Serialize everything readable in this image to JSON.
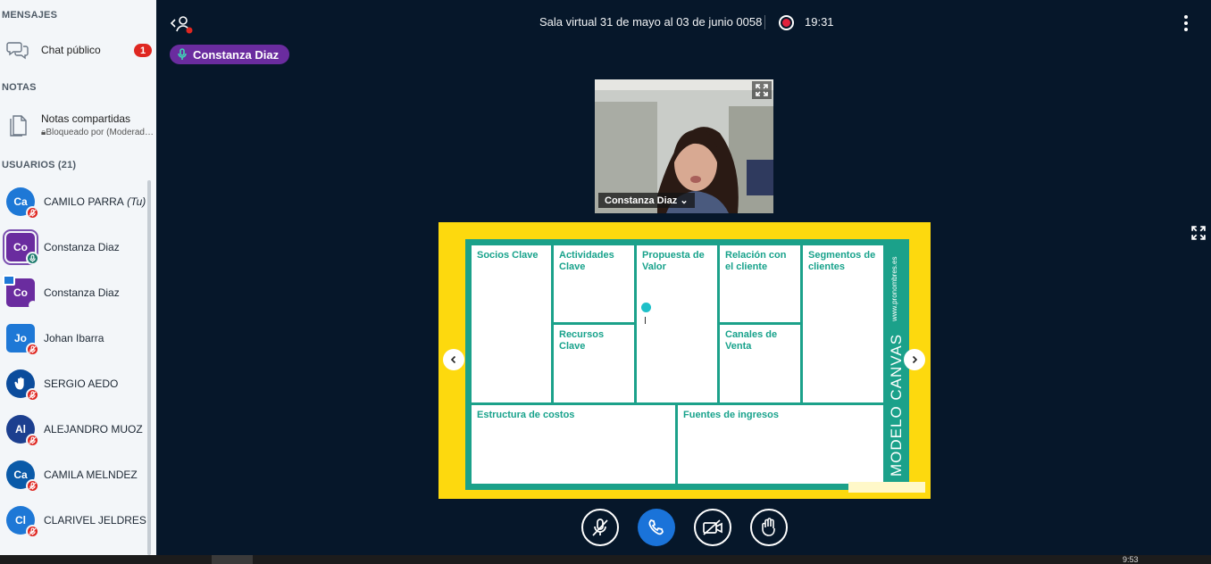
{
  "sidebar": {
    "messages_title": "MENSAJES",
    "public_chat_label": "Chat público",
    "public_chat_unread": "1",
    "notes_title": "NOTAS",
    "shared_notes_label": "Notas compartidas",
    "shared_notes_status": "Bloqueado por (Moderad…",
    "users_title": "USUARIOS (21)",
    "users": [
      {
        "initials": "Ca",
        "name": "CAMILO PARRA",
        "suffix": "(Tu)",
        "color": "#1e78d6",
        "shape": "round",
        "status": "muted"
      },
      {
        "initials": "Co",
        "name": "Constanza Diaz",
        "suffix": "",
        "color": "#6a2c9f",
        "shape": "square",
        "status": "talking"
      },
      {
        "initials": "Co",
        "name": "Constanza Diaz",
        "suffix": "",
        "color": "#6a2c9f",
        "shape": "square",
        "status": "presenter"
      },
      {
        "initials": "Jo",
        "name": "Johan Ibarra",
        "suffix": "",
        "color": "#1e78d6",
        "shape": "square",
        "status": "muted"
      },
      {
        "initials": "",
        "name": "SERGIO AEDO",
        "suffix": "",
        "color": "#0b4c9c",
        "shape": "round",
        "status": "hand"
      },
      {
        "initials": "Al",
        "name": "ALEJANDRO MUOZ",
        "suffix": "",
        "color": "#1c3f8f",
        "shape": "round",
        "status": "muted"
      },
      {
        "initials": "Ca",
        "name": "CAMILA MELNDEZ",
        "suffix": "",
        "color": "#0a5aa8",
        "shape": "round",
        "status": "muted"
      },
      {
        "initials": "Cl",
        "name": "CLARIVEL JELDRES",
        "suffix": "",
        "color": "#1e78d6",
        "shape": "round",
        "status": "muted"
      }
    ]
  },
  "header": {
    "room_title": "Sala virtual 31 de mayo al 03 de junio 0058",
    "recording_time": "19:31",
    "talking_indicator": "Constanza Diaz"
  },
  "webcam": {
    "name_label": "Constanza Diaz"
  },
  "slide": {
    "cells": {
      "socios": "Socios Clave",
      "actividades": "Actividades Clave",
      "propuesta": "Propuesta de Valor",
      "relacion": "Relación con el cliente",
      "segmentos": "Segmentos de clientes",
      "recursos": "Recursos Clave",
      "canales": "Canales de Venta",
      "estructura": "Estructura de costos",
      "fuentes": "Fuentes de ingresos"
    },
    "vertical_title": "MODELO CANVAS",
    "vertical_url": "www.pronombres.es"
  },
  "taskbar": {
    "clock": "9:53"
  },
  "colors": {
    "background": "#06172a",
    "slide_yellow": "#fdd90e",
    "canvas_green": "#1ba18a",
    "primary_blue": "#1a73d9",
    "talking_purple": "#6a2c9f",
    "alert_red": "#df2721"
  }
}
